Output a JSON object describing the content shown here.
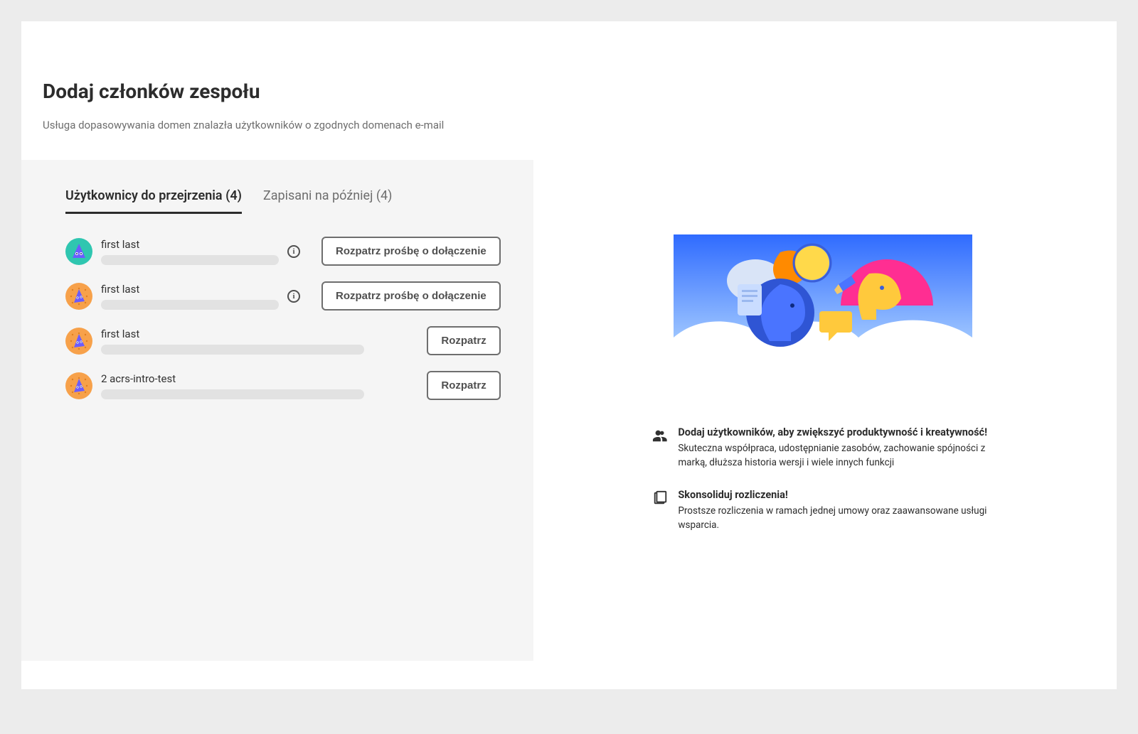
{
  "header": {
    "title": "Dodaj członków zespołu",
    "subtitle": "Usługa dopasowywania domen znalazła użytkowników o zgodnych domenach e-mail"
  },
  "tabs": {
    "review": {
      "label": "Użytkownicy do przejrzenia",
      "count": 4
    },
    "saved": {
      "label": "Zapisani na później",
      "count": 4
    }
  },
  "users": [
    {
      "name": "first last",
      "button": "Rozpatrz prośbę o dołączenie",
      "has_info": true,
      "bar": "short",
      "avatar": "teal"
    },
    {
      "name": "first last",
      "button": "Rozpatrz prośbę o dołączenie",
      "has_info": true,
      "bar": "short",
      "avatar": "orange"
    },
    {
      "name": "first last",
      "button": "Rozpatrz",
      "has_info": false,
      "bar": "long",
      "avatar": "orange"
    },
    {
      "name": "2 acrs-intro-test",
      "button": "Rozpatrz",
      "has_info": false,
      "bar": "long",
      "avatar": "orange"
    }
  ],
  "benefits": [
    {
      "icon": "people-icon",
      "title": "Dodaj użytkowników, aby zwiększyć produktywność i kreatywność!",
      "desc": "Skuteczna współpraca, udostępnianie zasobów, zachowanie spójności z marką, dłuższa historia wersji i wiele innych funkcji"
    },
    {
      "icon": "billing-icon",
      "title": "Skonsoliduj rozliczenia!",
      "desc": "Prostsze rozliczenia w ramach jednej umowy oraz zaawansowane usługi wsparcia."
    }
  ]
}
